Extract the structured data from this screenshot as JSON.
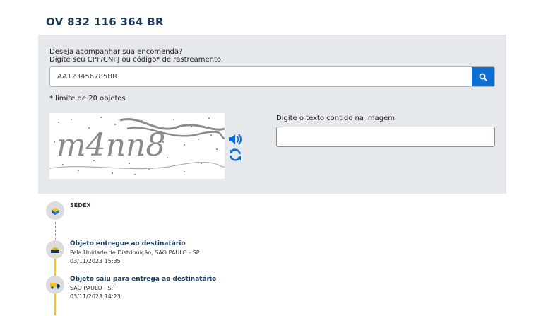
{
  "header": {
    "tracking_code": "OV 832 116 364 BR"
  },
  "search": {
    "intro_line1": "Deseja acompanhar sua encomenda?",
    "intro_line2": "Digite seu CPF/CNPJ ou código* de rastreamento.",
    "value": "AA123456785BR",
    "button_icon": "search-icon",
    "limit_note": "* limite de 20 objetos"
  },
  "captcha": {
    "text": "m4nn8",
    "label": "Digite o texto contido na imagem",
    "value": "",
    "audio_icon": "speaker-icon",
    "refresh_icon": "refresh-icon"
  },
  "timeline": {
    "service": "SEDEX",
    "events": [
      {
        "title": "Objeto entregue ao destinatário",
        "location": "Pela Unidade de Distribuição, SAO PAULO - SP",
        "datetime": "03/11/2023 15:35"
      },
      {
        "title": "Objeto saiu para entrega ao destinatário",
        "location": "SAO PAULO - SP",
        "datetime": "03/11/2023 14:23"
      }
    ]
  },
  "colors": {
    "accent": "#0b6fd6",
    "brand_dark": "#1b3a5b",
    "timeline_gold": "#f3c21b",
    "panel_bg": "#e6e9ec"
  }
}
